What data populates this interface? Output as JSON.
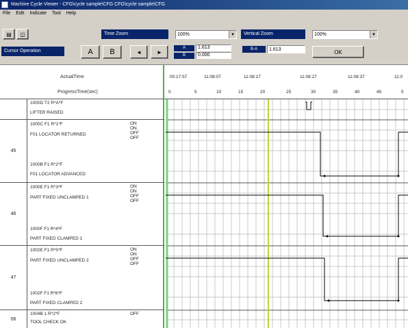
{
  "window": {
    "title": "Machine Cycle Viewer - CFG\\cycle sample\\CFG CFG\\cycle sample\\CFG"
  },
  "menu": [
    "File",
    "Edit",
    "Indicate",
    "Tool",
    "Help"
  ],
  "toolbar": {
    "time_zoom_label": "Time Zoom",
    "time_zoom_value": "100%",
    "vertical_zoom_label": "Vertical Zoom",
    "vertical_zoom_value": "100%",
    "cursor_operation_label": "Cursor Operation",
    "cursor_a_label": "A",
    "cursor_b_label": "B",
    "prev_label": "◄",
    "next_label": "►",
    "a_label": "A",
    "b_label": "B",
    "a_value": "1.613",
    "b_value": "0.000",
    "ba_label": "B-A",
    "ba_value": "1.613",
    "ok_label": "OK"
  },
  "header": {
    "actual_time_label": "ActualTime",
    "progress_time_label": "ProgressTime(sec)",
    "actual_times": [
      "00:17:57",
      "11:08:07",
      "11:08:17",
      "11:08:27",
      "11:08:37",
      "11:0"
    ],
    "progress_ticks": [
      "0",
      "5",
      "10",
      "15",
      "20",
      "25",
      "30",
      "35",
      "40",
      "45",
      "5"
    ]
  },
  "rows": [
    {
      "num": "",
      "signals": [
        "1000D T2 R*A*F",
        "LIFTER RAISED"
      ],
      "states": []
    },
    {
      "num": "45",
      "signals": [
        "1000C F1 R*1*F",
        "F01 LOCATOR RETURNED",
        "1000B F1 R*2*F",
        "F01 LOCATOR ADVANCED"
      ],
      "states": [
        "ON",
        "ON",
        "OFF",
        "OFF"
      ]
    },
    {
      "num": "46",
      "signals": [
        "1000E F1 R*3*F",
        "PART FIXED UNCLAMPED 1",
        "1000F F1 R*4*F",
        "PART FIXED CLAMPED 1"
      ],
      "states": [
        "ON",
        "ON",
        "OFF",
        "OFF"
      ]
    },
    {
      "num": "47",
      "signals": [
        "1002E F1 R*5*F",
        "PART FIXED UNCLAMPED 2",
        "1002F F1 R*6*F",
        "PART FIXED CLAMPED 2"
      ],
      "states": [
        "ON",
        "ON",
        "OFF",
        "OFF"
      ]
    },
    {
      "num": "06",
      "signals": [
        "1004B 1 R*2*F",
        "TOOL CHECK OK"
      ],
      "states": [
        "OFF"
      ]
    }
  ],
  "colors": {
    "grid": "#c8c8c8",
    "signal": "#000000",
    "cursor_a": "#7ed07e",
    "cursor_b": "#b6d43a",
    "title_bar": "#0a246a"
  }
}
